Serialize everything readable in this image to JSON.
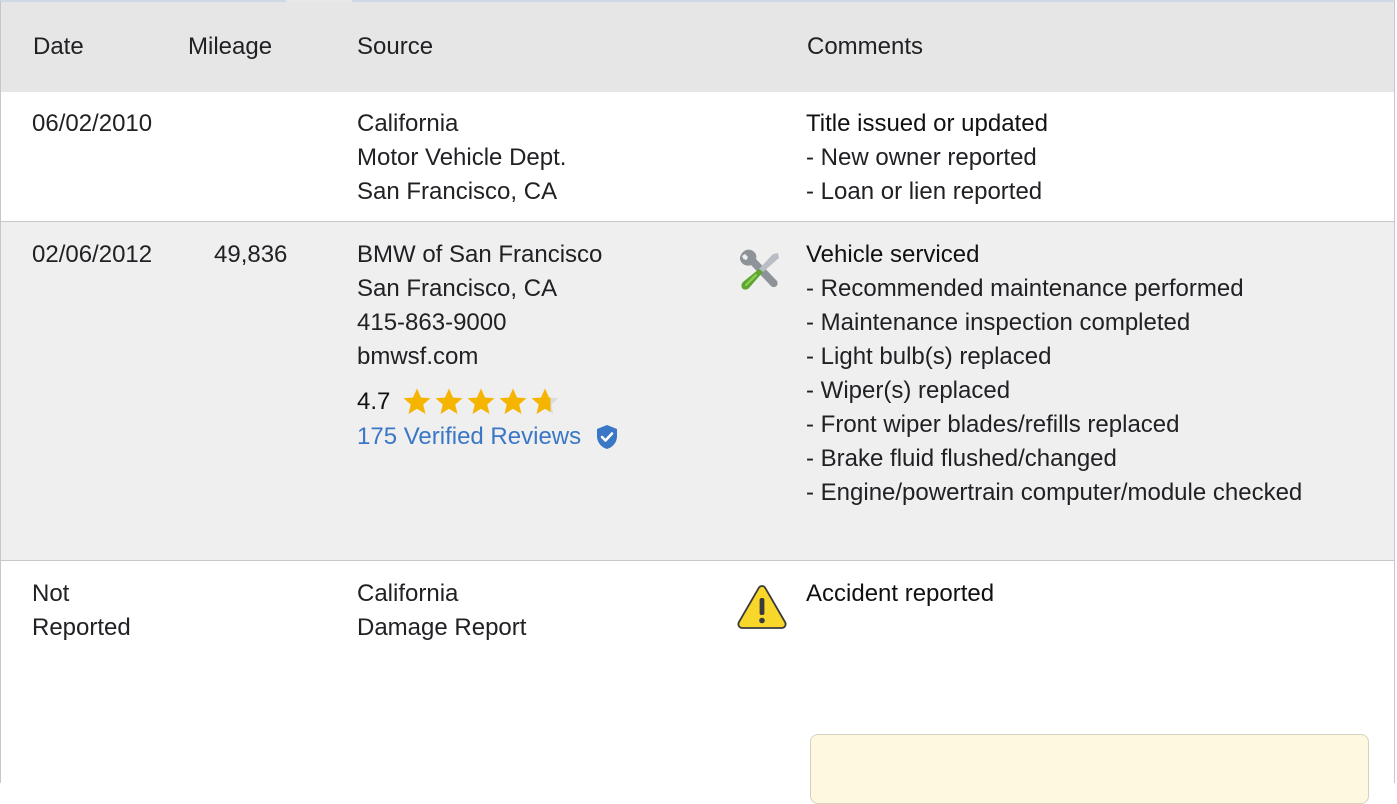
{
  "header": {
    "date": "Date",
    "mileage": "Mileage",
    "source": "Source",
    "comments": "Comments"
  },
  "rows": [
    {
      "date": "06/02/2010",
      "mileage": "",
      "source": [
        "California",
        "Motor Vehicle Dept.",
        "San Francisco, CA"
      ],
      "comment_title": "Title issued or updated",
      "comments": [
        "- New owner reported",
        "- Loan or lien reported"
      ],
      "icon": ""
    },
    {
      "date": "02/06/2012",
      "mileage": "49,836",
      "source": [
        "BMW of San Francisco",
        "San Francisco, CA",
        "415-863-9000",
        "bmwsf.com"
      ],
      "rating": {
        "value": "4.7",
        "stars": 4.7,
        "reviews_link": "175 Verified Reviews"
      },
      "comment_title": "Vehicle serviced",
      "comments": [
        "- Recommended maintenance performed",
        "- Maintenance inspection completed",
        "- Light bulb(s) replaced",
        "- Wiper(s) replaced",
        "- Front wiper blades/refills replaced",
        "- Brake fluid flushed/changed",
        "- Engine/powertrain computer/module checked"
      ],
      "icon": "wrench-screwdriver-icon"
    },
    {
      "date_line1": "Not",
      "date_line2": "Reported",
      "mileage": "",
      "source": [
        "California",
        "Damage Report"
      ],
      "comment_title": "Accident reported",
      "comments": [],
      "icon": "warning-triangle-icon"
    }
  ],
  "colors": {
    "header_bg": "#e6e6e6",
    "alt_row_bg": "#efefef",
    "link": "#3a77c6",
    "star": "#f5b400",
    "note_bg": "#fff8e1"
  }
}
